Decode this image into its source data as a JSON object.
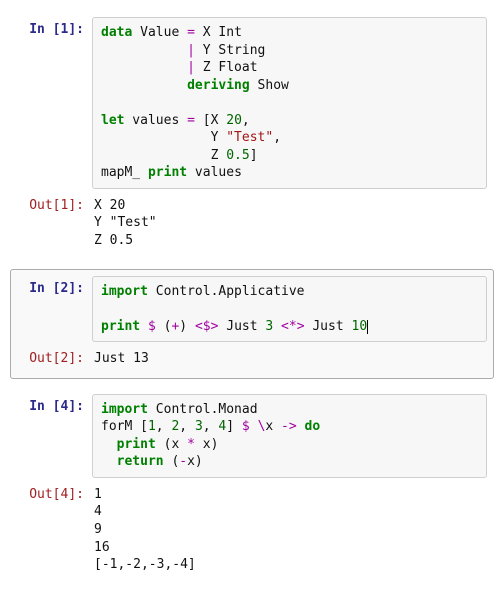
{
  "cells": [
    {
      "in_label": "In [1]:",
      "out_label": "Out[1]:",
      "selected": false,
      "code_tokens": [
        {
          "t": "data",
          "c": "kw"
        },
        {
          "t": " Value "
        },
        {
          "t": "=",
          "c": "op"
        },
        {
          "t": " X Int\n"
        },
        {
          "t": "           "
        },
        {
          "t": "|",
          "c": "op"
        },
        {
          "t": " Y String\n"
        },
        {
          "t": "           "
        },
        {
          "t": "|",
          "c": "op"
        },
        {
          "t": " Z Float\n"
        },
        {
          "t": "           "
        },
        {
          "t": "deriving",
          "c": "kw"
        },
        {
          "t": " Show\n"
        },
        {
          "t": "\n"
        },
        {
          "t": "let",
          "c": "kw"
        },
        {
          "t": " values "
        },
        {
          "t": "=",
          "c": "op"
        },
        {
          "t": " [X "
        },
        {
          "t": "20",
          "c": "num"
        },
        {
          "t": ",\n"
        },
        {
          "t": "              Y "
        },
        {
          "t": "\"Test\"",
          "c": "str"
        },
        {
          "t": ",\n"
        },
        {
          "t": "              Z "
        },
        {
          "t": "0.5",
          "c": "num"
        },
        {
          "t": "]\n"
        },
        {
          "t": "mapM_ "
        },
        {
          "t": "print",
          "c": "builtin"
        },
        {
          "t": " values"
        }
      ],
      "output": "X 20\nY \"Test\"\nZ 0.5"
    },
    {
      "in_label": "In [2]:",
      "out_label": "Out[2]:",
      "selected": true,
      "code_tokens": [
        {
          "t": "import",
          "c": "kw"
        },
        {
          "t": " Control.Applicative\n"
        },
        {
          "t": "\n"
        },
        {
          "t": "print",
          "c": "builtin"
        },
        {
          "t": " "
        },
        {
          "t": "$",
          "c": "op"
        },
        {
          "t": " ("
        },
        {
          "t": "+",
          "c": "op"
        },
        {
          "t": ") "
        },
        {
          "t": "<$>",
          "c": "op"
        },
        {
          "t": " Just "
        },
        {
          "t": "3",
          "c": "num"
        },
        {
          "t": " "
        },
        {
          "t": "<*>",
          "c": "op"
        },
        {
          "t": " Just "
        },
        {
          "t": "10",
          "c": "num"
        }
      ],
      "has_cursor": true,
      "output": "Just 13"
    },
    {
      "in_label": "In [4]:",
      "out_label": "Out[4]:",
      "selected": false,
      "code_tokens": [
        {
          "t": "import",
          "c": "kw"
        },
        {
          "t": " Control.Monad\n"
        },
        {
          "t": "forM ["
        },
        {
          "t": "1",
          "c": "num"
        },
        {
          "t": ", "
        },
        {
          "t": "2",
          "c": "num"
        },
        {
          "t": ", "
        },
        {
          "t": "3",
          "c": "num"
        },
        {
          "t": ", "
        },
        {
          "t": "4",
          "c": "num"
        },
        {
          "t": "] "
        },
        {
          "t": "$",
          "c": "op"
        },
        {
          "t": " "
        },
        {
          "t": "\\",
          "c": "op"
        },
        {
          "t": "x "
        },
        {
          "t": "->",
          "c": "op"
        },
        {
          "t": " "
        },
        {
          "t": "do",
          "c": "kw"
        },
        {
          "t": "\n"
        },
        {
          "t": "  "
        },
        {
          "t": "print",
          "c": "builtin"
        },
        {
          "t": " (x "
        },
        {
          "t": "*",
          "c": "op"
        },
        {
          "t": " x)\n"
        },
        {
          "t": "  "
        },
        {
          "t": "return",
          "c": "builtin"
        },
        {
          "t": " ("
        },
        {
          "t": "-",
          "c": "op"
        },
        {
          "t": "x)"
        }
      ],
      "output": "1\n4\n9\n16\n[-1,-2,-3,-4]"
    }
  ]
}
